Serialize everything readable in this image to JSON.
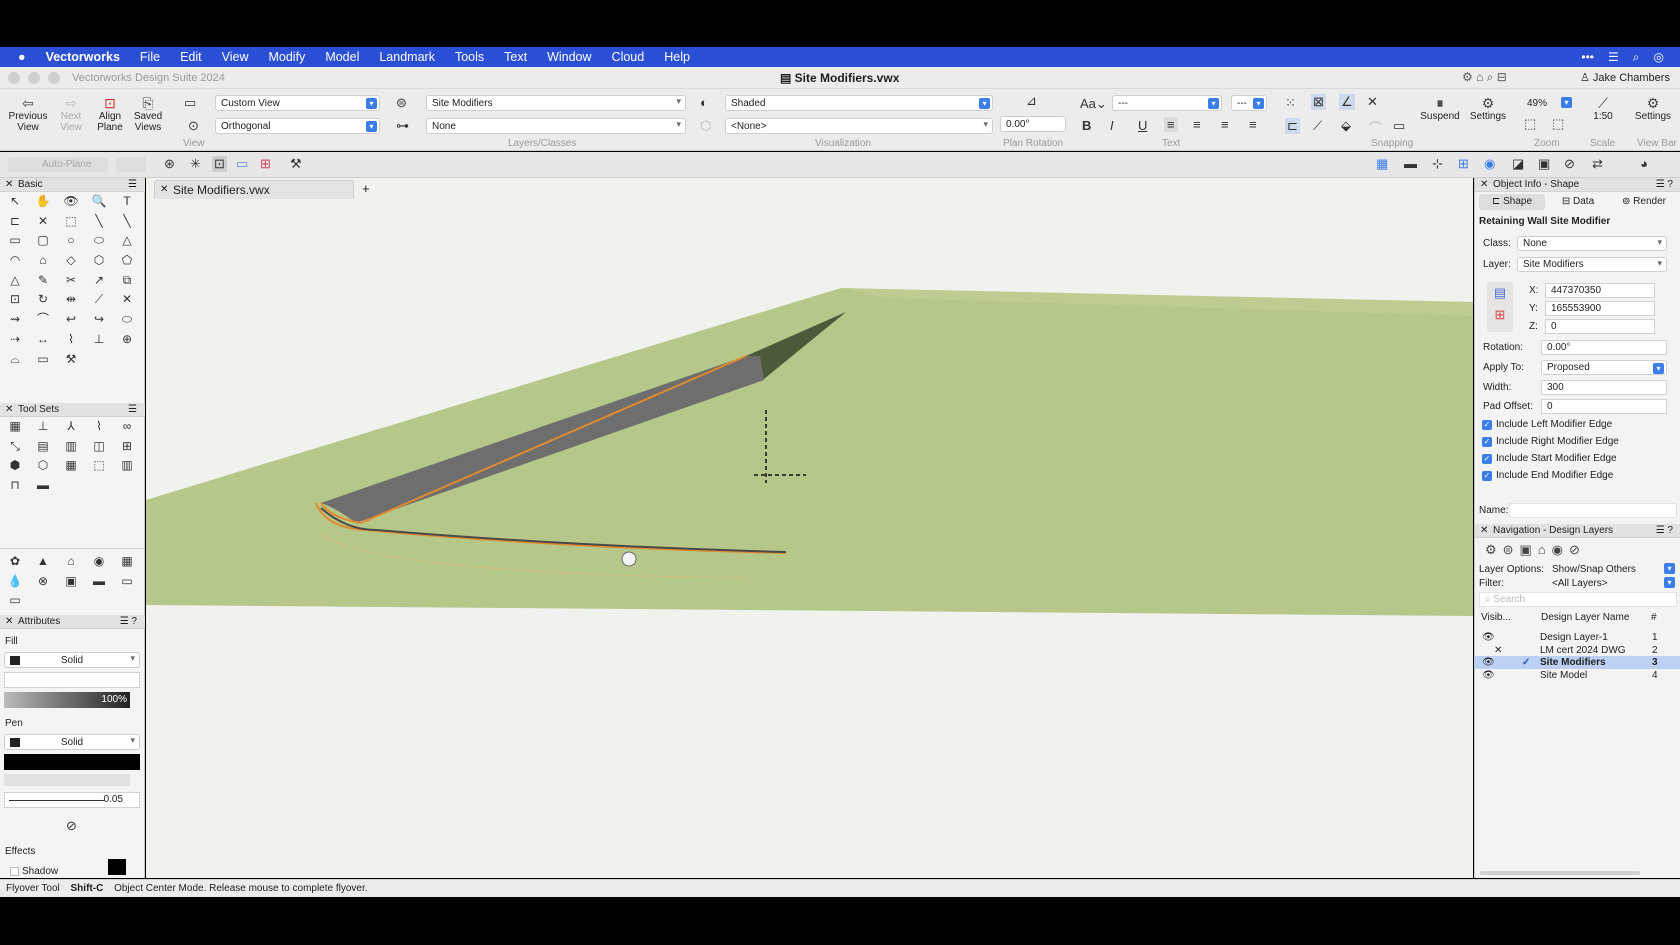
{
  "menubar": {
    "apple": "",
    "app": "Vectorworks",
    "items": [
      "File",
      "Edit",
      "View",
      "Modify",
      "Model",
      "Landmark",
      "Tools",
      "Text",
      "Window",
      "Cloud",
      "Help"
    ],
    "right_icons": [
      "more-icon",
      "control-center-icon",
      "search-icon",
      "siri-icon"
    ]
  },
  "window": {
    "app_title": "Vectorworks Design Suite 2024",
    "doc_title": "Site Modifiers.vwx",
    "user": "Jake Chambers"
  },
  "toolbar": {
    "prev_view": "Previous View",
    "next_view": "Next View",
    "align_plane": "Align Plane",
    "saved_views": "Saved Views",
    "view_select": "Custom View",
    "projection": "Orthogonal",
    "group_view": "View",
    "layer_select": "Site Modifiers",
    "class_select": "None",
    "group_layers": "Layers/Classes",
    "render_mode": "Shaded",
    "render_style": "<None>",
    "group_visualization": "Visualization",
    "plan_rotation": "0.00°",
    "group_plan_rotation": "Plan Rotation",
    "font_size_label": "Aa",
    "font_select": "---",
    "font_size_select": "---",
    "group_text": "Text",
    "bold": "B",
    "italic": "I",
    "underline": "U",
    "suspend": "Suspend",
    "snap_settings": "Settings",
    "group_snapping": "Snapping",
    "zoom": "49%",
    "group_zoom": "Zoom",
    "scale": "1:50",
    "group_scale": "Scale",
    "settings": "Settings",
    "group_viewbar": "View Bar",
    "auto_plane": "Auto-Plane"
  },
  "doc_tab": {
    "name": "Site Modifiers.vwx",
    "add": "+"
  },
  "left": {
    "basic_title": "Basic",
    "basic_tools": [
      "↖",
      "✋",
      "👁",
      "🔍",
      "T",
      "⊏",
      "✕",
      "⬚",
      "╲",
      "╲",
      "▭",
      "▢",
      "○",
      "⬭",
      "△",
      "◠",
      "⌂",
      "◇",
      "⬡",
      "⬠",
      "△",
      "✎",
      "✂",
      "↗",
      "⧉",
      "⊡",
      "↻",
      "⇹",
      "⟋",
      "✕",
      "⇝",
      "⌒",
      "↩",
      "↪",
      "⬭",
      "⇢",
      "↔",
      "⌇",
      "⊥",
      "⊕",
      "⌓",
      "▭",
      "⚒"
    ],
    "toolsets_title": "Tool Sets",
    "toolsets": [
      "▦",
      "⊥",
      "⅄",
      "⌇",
      "∞",
      "⤡",
      "▤",
      "▥",
      "◫",
      "⊞",
      "⬢",
      "⬡",
      "▦",
      "⬚",
      "▥",
      "⊓",
      "▬"
    ],
    "palette2": [
      "✿",
      "▲",
      "⌂",
      "◉",
      "▦",
      "💧",
      "⊗",
      "▣",
      "▬",
      "▭",
      "▭"
    ],
    "attributes_title": "Attributes",
    "fill_label": "Fill",
    "fill_type": "Solid",
    "opacity": "100%",
    "pen_label": "Pen",
    "pen_type": "Solid",
    "line_weight": "0.05",
    "effects_label": "Effects",
    "shadow_label": "Shadow"
  },
  "objinfo": {
    "title": "Object Info - Shape",
    "tabs": [
      "Shape",
      "Data",
      "Render"
    ],
    "object_type": "Retaining Wall Site Modifier",
    "class_label": "Class:",
    "class_value": "None",
    "layer_label": "Layer:",
    "layer_value": "Site Modifiers",
    "x_label": "X:",
    "x": "447370350",
    "y_label": "Y:",
    "y": "165553900",
    "z_label": "Z:",
    "z": "0",
    "rotation_label": "Rotation:",
    "rotation": "0.00°",
    "apply_label": "Apply To:",
    "apply": "Proposed",
    "width_label": "Width:",
    "width": "300",
    "pad_label": "Pad Offset:",
    "pad": "0",
    "checks": [
      "Include Left Modifier Edge",
      "Include Right Modifier Edge",
      "Include Start Modifier Edge",
      "Include End Modifier Edge"
    ],
    "name_label": "Name:"
  },
  "nav": {
    "title": "Navigation - Design Layers",
    "layer_options_label": "Layer Options:",
    "layer_options": "Show/Snap Others",
    "filter_label": "Filter:",
    "filter": "<All Layers>",
    "search": "Search",
    "col_vis": "Visib...",
    "col_name": "Design Layer Name",
    "col_num": "#",
    "layers": [
      {
        "name": "Design Layer-1",
        "num": "1",
        "vis": "👁",
        "mark": ""
      },
      {
        "name": "LM cert 2024 DWG",
        "num": "2",
        "vis": "",
        "mark": "✕"
      },
      {
        "name": "Site Modifiers",
        "num": "3",
        "vis": "👁",
        "mark": "✓"
      },
      {
        "name": "Site Model",
        "num": "4",
        "vis": "👁",
        "mark": ""
      }
    ]
  },
  "status": {
    "tool": "Flyover Tool",
    "shortcut": "Shift-C",
    "message": "Object Center Mode. Release mouse to complete flyover."
  },
  "colors": {
    "menubar": "#2a4fd4",
    "accent": "#3b7de9",
    "terrain": "#b7c98a",
    "wall": "#6b6b6b",
    "orange_edge": "#e08a30"
  }
}
